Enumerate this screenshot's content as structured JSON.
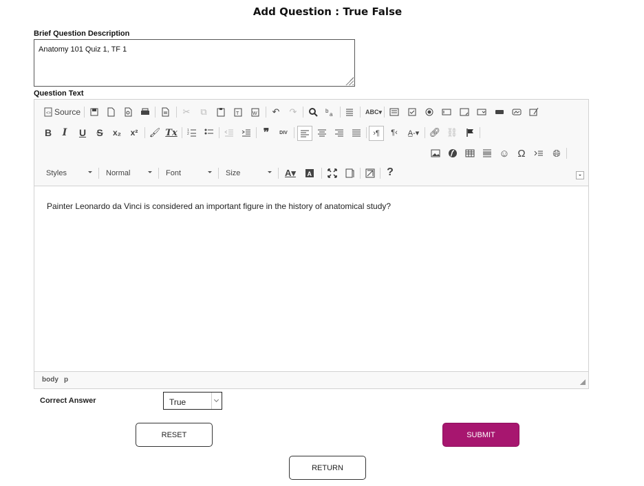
{
  "page": {
    "title": "Add Question : True False"
  },
  "brief_description": {
    "label": "Brief Question Description",
    "value": "Anatomy 101 Quiz 1, TF 1"
  },
  "question_text": {
    "label": "Question Text",
    "toolbar": {
      "source_label": "Source",
      "styles_label": "Styles",
      "format_label": "Normal",
      "font_label": "Font",
      "size_label": "Size",
      "help_label": "?"
    },
    "content": "Painter Leonardo da Vinci is considered an important figure in the history of anatomical study?",
    "path": [
      "body",
      "p"
    ]
  },
  "correct_answer": {
    "label": "Correct Answer",
    "value": "True"
  },
  "buttons": {
    "reset": "RESET",
    "submit": "SUBMIT",
    "return": "RETURN"
  },
  "colors": {
    "submit_bg": "#a7166f",
    "toolbar_bg": "#f8f8f8"
  }
}
